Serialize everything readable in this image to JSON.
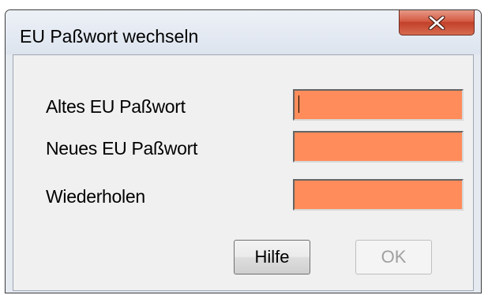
{
  "window": {
    "title": "EU Paßwort wechseln",
    "close_icon": "close-x-icon"
  },
  "fields": [
    {
      "label": "Altes EU Paßwort",
      "value": "",
      "has_focus": true
    },
    {
      "label": "Neues EU Paßwort",
      "value": ""
    },
    {
      "label": "Wiederholen",
      "value": ""
    }
  ],
  "buttons": {
    "help_label": "Hilfe",
    "ok_label": "OK",
    "ok_enabled": false
  },
  "colors": {
    "input_background": "#ff8c5a",
    "close_button": "#c9482f"
  }
}
